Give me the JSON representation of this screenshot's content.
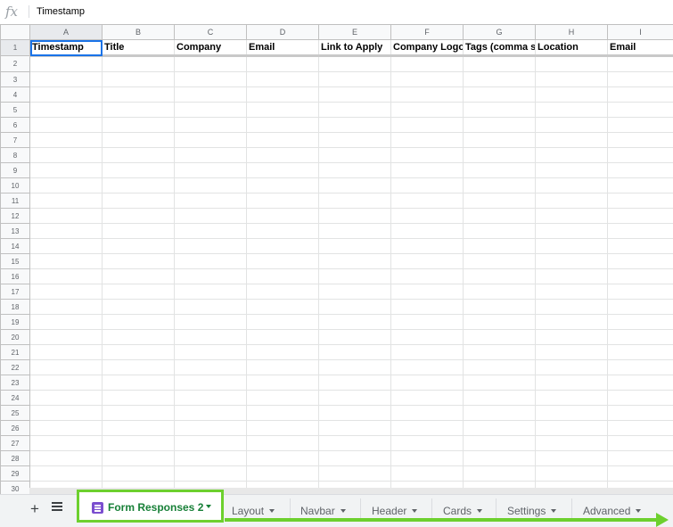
{
  "formula_bar": {
    "fx_label": "fx",
    "value": "Timestamp"
  },
  "columns": [
    "A",
    "B",
    "C",
    "D",
    "E",
    "F",
    "G",
    "H",
    "I"
  ],
  "header_row": {
    "row_number": "1",
    "cells": [
      "Timestamp",
      "Title",
      "Company",
      "Email",
      "Link to Apply",
      "Company Logo",
      "Tags (comma se",
      "Location",
      "Email"
    ]
  },
  "row_numbers": [
    "2",
    "3",
    "4",
    "5",
    "6",
    "7",
    "8",
    "9",
    "10",
    "11",
    "12",
    "13",
    "14",
    "15",
    "16",
    "17",
    "18",
    "19",
    "20",
    "21",
    "22",
    "23",
    "24",
    "25",
    "26",
    "27",
    "28",
    "29",
    "30"
  ],
  "selected_cell": "A1",
  "sheet_tabs": {
    "add_label": "+",
    "active": "Form Responses 2",
    "others": [
      "Layout",
      "Navbar",
      "Header",
      "Cards",
      "Settings",
      "Advanced"
    ]
  },
  "colors": {
    "annotation_green": "#6dd02e",
    "active_tab_text": "#188038",
    "form_icon": "#7b4fcf",
    "selection": "#1a73e8"
  }
}
